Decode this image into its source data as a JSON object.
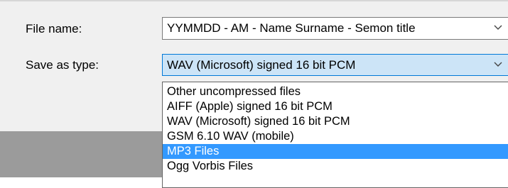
{
  "form": {
    "file_name_label": "File name:",
    "file_name_value": "YYMMDD - AM - Name Surname - Semon title",
    "save_type_label": "Save as type:",
    "save_type_value": "WAV (Microsoft) signed 16 bit PCM"
  },
  "dropdown": {
    "options": [
      "Other uncompressed files",
      "AIFF (Apple) signed 16 bit PCM",
      "WAV (Microsoft) signed 16 bit PCM",
      "GSM 6.10 WAV (mobile)",
      "MP3 Files",
      "Ogg Vorbis Files"
    ],
    "highlighted_option": "MP3 Files"
  },
  "icons": {
    "combo_arrow": "chevron-down-icon"
  },
  "colors": {
    "selection": "#3399ff",
    "focus_border": "#0078d7",
    "focus_fill": "#cce4f7"
  }
}
